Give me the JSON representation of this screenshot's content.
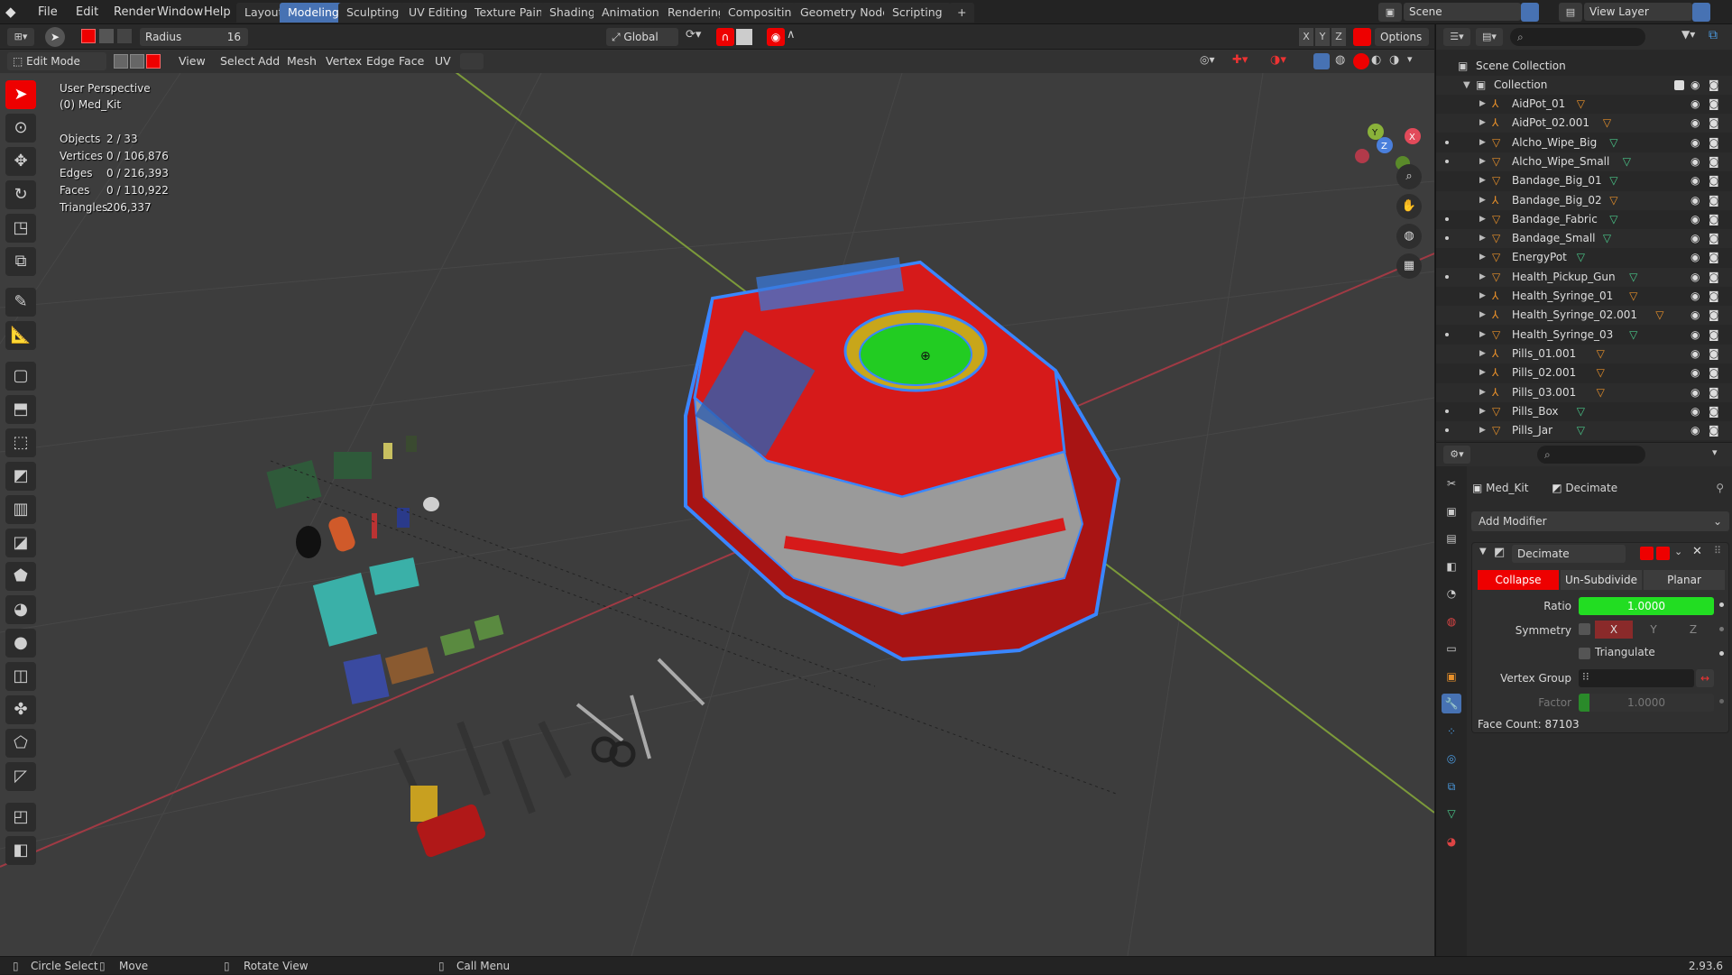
{
  "menus": [
    "File",
    "Edit",
    "Render",
    "Window",
    "Help"
  ],
  "workspace_tabs": [
    {
      "label": "Layout",
      "active": false
    },
    {
      "label": "Modeling",
      "active": true
    },
    {
      "label": "Sculpting",
      "active": false
    },
    {
      "label": "UV Editing",
      "active": false
    },
    {
      "label": "Texture Paint",
      "active": false
    },
    {
      "label": "Shading",
      "active": false
    },
    {
      "label": "Animation",
      "active": false
    },
    {
      "label": "Rendering",
      "active": false
    },
    {
      "label": "Compositing",
      "active": false
    },
    {
      "label": "Geometry Nodes",
      "active": false
    },
    {
      "label": "Scripting",
      "active": false
    }
  ],
  "add_workspace": "+",
  "scene": "Scene",
  "view_layer": "View Layer",
  "tool_settings": {
    "radius_label": "Radius",
    "radius_value": "16",
    "orientation": "Global",
    "options": "Options",
    "axes": [
      "X",
      "Y",
      "Z"
    ]
  },
  "viewport_header": {
    "mode": "Edit Mode",
    "menus": [
      "View",
      "Select",
      "Add",
      "Mesh",
      "Vertex",
      "Edge",
      "Face",
      "UV"
    ]
  },
  "overlay": {
    "perspective": "User Perspective",
    "object": "(0) Med_Kit",
    "stats": [
      {
        "label": "Objects",
        "value": "2 / 33"
      },
      {
        "label": "Vertices",
        "value": "0 / 106,876"
      },
      {
        "label": "Edges",
        "value": "0 / 216,393"
      },
      {
        "label": "Faces",
        "value": "0 / 110,922"
      },
      {
        "label": "Triangles",
        "value": "206,337"
      }
    ]
  },
  "outliner": {
    "root": "Scene Collection",
    "collection": "Collection",
    "items": [
      {
        "name": "AidPot_01",
        "type": "armature",
        "dot": false
      },
      {
        "name": "AidPot_02.001",
        "type": "armature",
        "dot": false
      },
      {
        "name": "Alcho_Wipe_Big",
        "type": "mesh",
        "dot": true
      },
      {
        "name": "Alcho_Wipe_Small",
        "type": "mesh",
        "dot": true
      },
      {
        "name": "Bandage_Big_01",
        "type": "mesh",
        "dot": false
      },
      {
        "name": "Bandage_Big_02",
        "type": "armature",
        "dot": false
      },
      {
        "name": "Bandage_Fabric",
        "type": "mesh",
        "dot": true
      },
      {
        "name": "Bandage_Small",
        "type": "mesh",
        "dot": true
      },
      {
        "name": "EnergyPot",
        "type": "mesh",
        "dot": false
      },
      {
        "name": "Health_Pickup_Gun",
        "type": "mesh",
        "dot": true
      },
      {
        "name": "Health_Syringe_01",
        "type": "armature",
        "dot": false
      },
      {
        "name": "Health_Syringe_02.001",
        "type": "armature",
        "dot": false
      },
      {
        "name": "Health_Syringe_03",
        "type": "mesh",
        "dot": true
      },
      {
        "name": "Pills_01.001",
        "type": "armature",
        "dot": false
      },
      {
        "name": "Pills_02.001",
        "type": "armature",
        "dot": false
      },
      {
        "name": "Pills_03.001",
        "type": "armature",
        "dot": false
      },
      {
        "name": "Pills_Box",
        "type": "mesh",
        "dot": true
      },
      {
        "name": "Pills_Jar",
        "type": "mesh",
        "dot": true
      }
    ]
  },
  "properties": {
    "object": "Med_Kit",
    "modifier_context": "Decimate",
    "add_modifier": "Add Modifier",
    "modifier_name": "Decimate",
    "modes": [
      {
        "label": "Collapse",
        "active": true
      },
      {
        "label": "Un-Subdivide",
        "active": false
      },
      {
        "label": "Planar",
        "active": false
      }
    ],
    "ratio_label": "Ratio",
    "ratio_value": "1.0000",
    "ratio_fraction": 1.0,
    "symmetry_label": "Symmetry",
    "sym_axes": [
      "X",
      "Y",
      "Z"
    ],
    "triangulate_label": "Triangulate",
    "vertex_group_label": "Vertex Group",
    "factor_label": "Factor",
    "factor_value": "1.0000",
    "face_count": "Face Count: 87103"
  },
  "statusbar": {
    "items": [
      "Circle Select",
      "Move",
      "Rotate View",
      "Call Menu"
    ],
    "version": "2.93.6"
  },
  "colors": {
    "accent": "#4772b3",
    "active_red": "#e00000",
    "ratio_green": "#22dd22",
    "mesh_red": "#d81818"
  }
}
